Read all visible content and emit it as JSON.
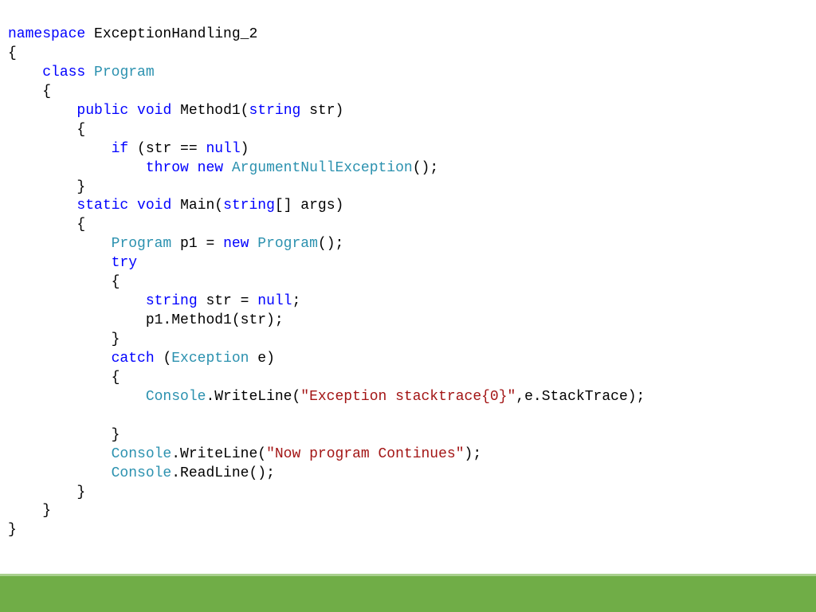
{
  "code": {
    "l1a": "namespace",
    "l1b": " ExceptionHandling_2",
    "l2": "{",
    "l3a": "    ",
    "l3b": "class",
    "l3c": " ",
    "l3d": "Program",
    "l4": "    {",
    "l5a": "        ",
    "l5b": "public",
    "l5c": " ",
    "l5d": "void",
    "l5e": " Method1(",
    "l5f": "string",
    "l5g": " str)",
    "l6": "        {",
    "l7a": "            ",
    "l7b": "if",
    "l7c": " (str == ",
    "l7d": "null",
    "l7e": ")",
    "l8a": "                ",
    "l8b": "throw",
    "l8c": " ",
    "l8d": "new",
    "l8e": " ",
    "l8f": "ArgumentNullException",
    "l8g": "();",
    "l9": "        }",
    "l10a": "        ",
    "l10b": "static",
    "l10c": " ",
    "l10d": "void",
    "l10e": " Main(",
    "l10f": "string",
    "l10g": "[] args)",
    "l11": "        {",
    "l12a": "            ",
    "l12b": "Program",
    "l12c": " p1 = ",
    "l12d": "new",
    "l12e": " ",
    "l12f": "Program",
    "l12g": "();",
    "l13a": "            ",
    "l13b": "try",
    "l14": "            {",
    "l15a": "                ",
    "l15b": "string",
    "l15c": " str = ",
    "l15d": "null",
    "l15e": ";",
    "l16": "                p1.Method1(str);",
    "l17": "            }",
    "l18a": "            ",
    "l18b": "catch",
    "l18c": " (",
    "l18d": "Exception",
    "l18e": " e)",
    "l19": "            {",
    "l20a": "                ",
    "l20b": "Console",
    "l20c": ".WriteLine(",
    "l20d": "\"Exception stacktrace{0}\"",
    "l20e": ",e.StackTrace);",
    "l21": "",
    "l22": "            }",
    "l23a": "            ",
    "l23b": "Console",
    "l23c": ".WriteLine(",
    "l23d": "\"Now program Continues\"",
    "l23e": ");",
    "l24a": "            ",
    "l24b": "Console",
    "l24c": ".ReadLine();",
    "l25": "        }",
    "l26": "    }",
    "l27": "}"
  },
  "colors": {
    "keyword": "#0000ff",
    "type": "#2b91af",
    "string": "#a31515",
    "text": "#000000",
    "footer": "#70ad47"
  }
}
